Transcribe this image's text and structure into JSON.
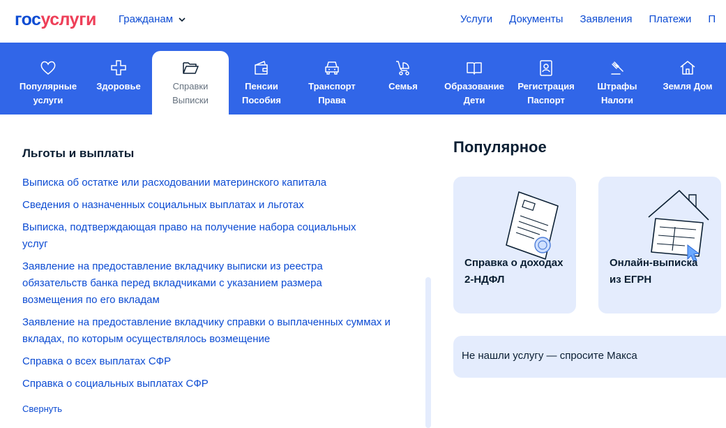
{
  "header": {
    "logo_part1": "гос",
    "logo_part2": "услуги",
    "audience": "Гражданам",
    "nav": [
      "Услуги",
      "Документы",
      "Заявления",
      "Платежи",
      "П"
    ]
  },
  "categories": [
    {
      "line1": "Популярные",
      "line2": "услуги",
      "icon": "heart-icon"
    },
    {
      "line1": "Здоровье",
      "line2": "",
      "icon": "medical-cross-icon"
    },
    {
      "line1": "Справки",
      "line2": "Выписки",
      "icon": "folder-icon"
    },
    {
      "line1": "Пенсии",
      "line2": "Пособия",
      "icon": "wallet-icon"
    },
    {
      "line1": "Транспорт",
      "line2": "Права",
      "icon": "car-icon"
    },
    {
      "line1": "Семья",
      "line2": "",
      "icon": "stroller-icon"
    },
    {
      "line1": "Образование",
      "line2": "Дети",
      "icon": "book-icon"
    },
    {
      "line1": "Регистрация",
      "line2": "Паспорт",
      "icon": "id-card-icon"
    },
    {
      "line1": "Штрафы",
      "line2": "Налоги",
      "icon": "gavel-icon"
    },
    {
      "line1": "Земля Дом",
      "line2": "",
      "icon": "house-icon"
    }
  ],
  "section": {
    "title": "Льготы и выплаты",
    "links": [
      "Выписка об остатке или расходовании материнского капитала",
      "Сведения о назначенных социальных выплатах и льготах",
      "Выписка, подтверждающая право на получение набора социальных услуг",
      "Заявление на предоставление вкладчику выписки из реестра обязательств банка перед вкладчиками с указанием размера возмещения по его вкладам",
      "Заявление на предоставление вкладчику справки о выплаченных суммах и вкладах, по которым осуществлялось возмещение",
      "Справка о всех выплатах СФР",
      "Справка о социальных выплатах СФР"
    ],
    "collapse": "Свернуть"
  },
  "popular": {
    "title": "Популярное",
    "cards": [
      "Справка о доходах\n2-НДФЛ",
      "Онлайн-выписка\nиз ЕГРН"
    ],
    "ask": "Не нашли услугу — спросите Макса"
  }
}
